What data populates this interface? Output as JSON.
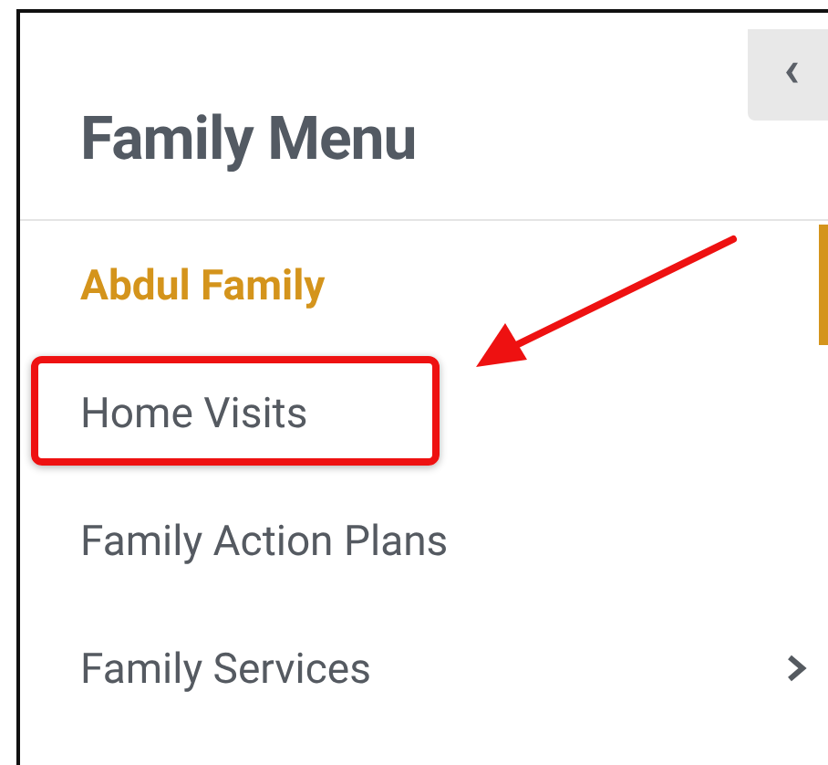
{
  "menu": {
    "title": "Family Menu",
    "collapse_icon": "‹",
    "items": [
      {
        "label": "Abdul Family",
        "selected": true,
        "highlighted": false,
        "has_submenu": false
      },
      {
        "label": "Home Visits",
        "selected": false,
        "highlighted": true,
        "has_submenu": false
      },
      {
        "label": "Family Action Plans",
        "selected": false,
        "highlighted": false,
        "has_submenu": false
      },
      {
        "label": "Family Services",
        "selected": false,
        "highlighted": false,
        "has_submenu": true
      }
    ]
  }
}
